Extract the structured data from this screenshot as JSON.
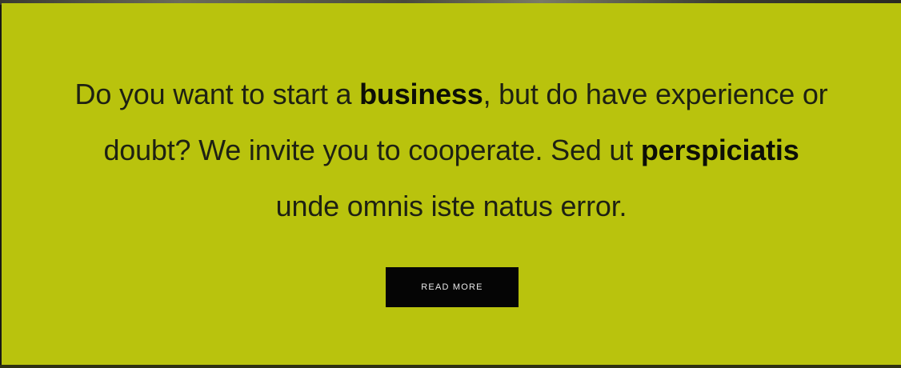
{
  "hero": {
    "background_color": "#b9c30d",
    "line1": {
      "pre": "Do you want to start a ",
      "bold": "business",
      "post": ", but do have experience or"
    },
    "line2": {
      "pre": "doubt? We invite you to cooperate. Sed ut ",
      "bold": "perspiciatis"
    },
    "line3": {
      "text": "unde omnis iste natus error."
    },
    "cta_label": "READ MORE"
  }
}
